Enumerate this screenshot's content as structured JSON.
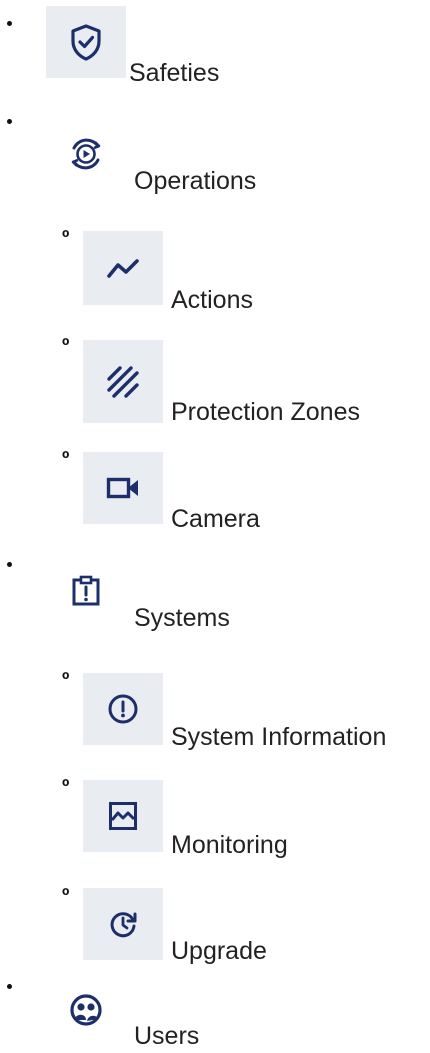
{
  "nav": {
    "safeties": {
      "label": "Safeties",
      "icon": "shield-check-icon"
    },
    "operations": {
      "label": "Operations",
      "icon": "cycle-play-icon",
      "children": {
        "actions": {
          "label": "Actions",
          "icon": "trend-line-icon"
        },
        "protection_zones": {
          "label": "Protection Zones",
          "icon": "hatch-lines-icon"
        },
        "camera": {
          "label": "Camera",
          "icon": "video-camera-icon"
        }
      }
    },
    "systems": {
      "label": "Systems",
      "icon": "clipboard-alert-icon",
      "children": {
        "system_information": {
          "label": "System Information",
          "icon": "alert-circle-icon"
        },
        "monitoring": {
          "label": "Monitoring",
          "icon": "chart-frame-icon"
        },
        "upgrade": {
          "label": "Upgrade",
          "icon": "refresh-clock-icon"
        }
      }
    },
    "users": {
      "label": "Users",
      "icon": "users-chat-icon"
    }
  },
  "sub_bullet_glyph": "º",
  "colors": {
    "icon": "#1d2f6a",
    "icon_bg": "#e9ecf1",
    "text": "#222222"
  }
}
